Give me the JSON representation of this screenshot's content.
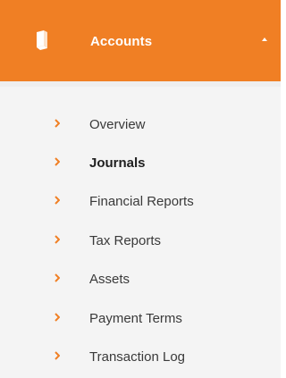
{
  "colors": {
    "accent": "#f07f24",
    "text": "#3a3a3a",
    "active_text": "#1f1f1f",
    "submenu_bg": "#f4f4f4"
  },
  "header": {
    "icon": "book-icon",
    "title": "Accounts",
    "toggle_icon": "caret-up-icon"
  },
  "menu": {
    "item_icon": "chevron-right-icon",
    "active_index": 1,
    "items": [
      {
        "label": "Overview"
      },
      {
        "label": "Journals"
      },
      {
        "label": "Financial Reports"
      },
      {
        "label": "Tax Reports"
      },
      {
        "label": "Assets"
      },
      {
        "label": "Payment Terms"
      },
      {
        "label": "Transaction Log"
      }
    ]
  }
}
